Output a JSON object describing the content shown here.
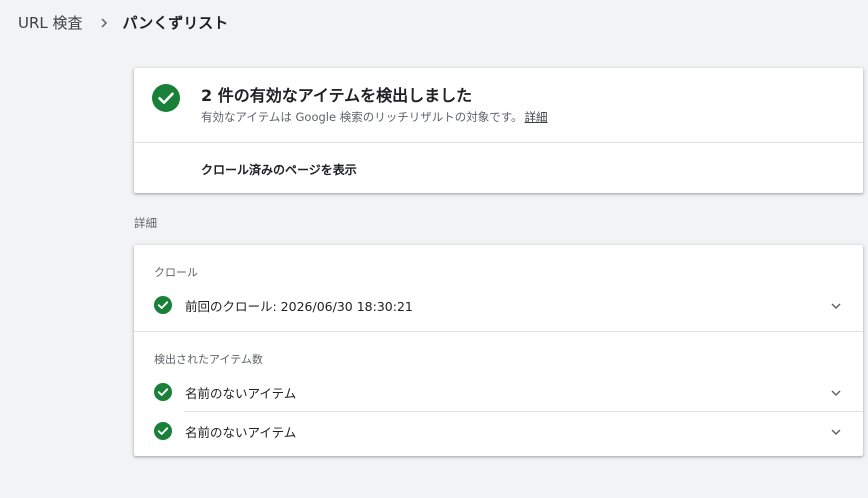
{
  "breadcrumb": {
    "root": "URL 検査",
    "current": "パンくずリスト"
  },
  "summary": {
    "title": "2 件の有効なアイテムを検出しました",
    "subtitle": "有効なアイテムは Google 検索のリッチリザルトの対象です。",
    "details_link": "詳細",
    "view_crawled": "クロール済みのページを表示"
  },
  "details": {
    "section_label": "詳細",
    "crawl": {
      "label": "クロール",
      "row": "前回のクロール: 2026/06/30 18:30:21"
    },
    "items": {
      "label": "検出されたアイテム数",
      "rows": [
        "名前のないアイテム",
        "名前のないアイテム"
      ]
    }
  },
  "colors": {
    "success": "#188038",
    "background": "#f1f3f4"
  }
}
